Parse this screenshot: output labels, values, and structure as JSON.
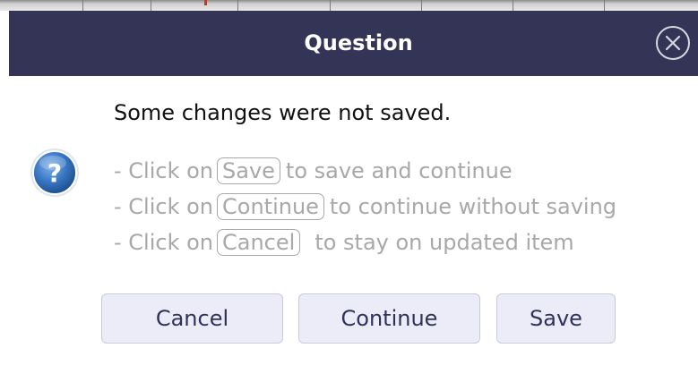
{
  "dialog": {
    "title": "Question",
    "message": "Some changes were not saved.",
    "icon": "question-icon",
    "close_icon": "close-circle-icon",
    "hints": [
      {
        "prefix": "- Click on",
        "key": "Save",
        "suffix": "to save and continue"
      },
      {
        "prefix": "- Click on",
        "key": "Continue",
        "suffix": "to continue without saving"
      },
      {
        "prefix": "- Click on",
        "key": "Cancel",
        "suffix": "to stay on updated item"
      }
    ],
    "buttons": {
      "cancel": "Cancel",
      "continue": "Continue",
      "save": "Save"
    }
  },
  "colors": {
    "title_bar": "#343556",
    "button_bg": "#ebecf7",
    "button_text": "#30325a",
    "hint_text": "#a8a8a8",
    "question_icon": "#2f6db5"
  }
}
